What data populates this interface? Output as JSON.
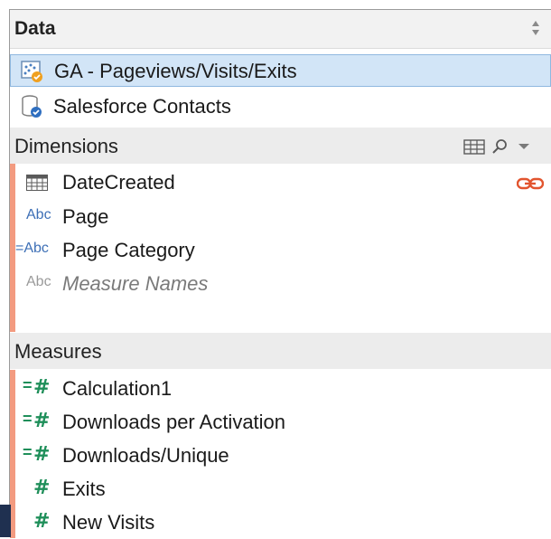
{
  "header": {
    "title": "Data"
  },
  "datasources": [
    {
      "label": "GA - Pageviews/Visits/Exits",
      "icon": "ga-datasource-icon",
      "selected": true
    },
    {
      "label": "Salesforce Contacts",
      "icon": "salesforce-datasource-icon",
      "selected": false
    }
  ],
  "dimensions": {
    "title": "Dimensions",
    "fields": [
      {
        "label": "DateCreated",
        "icon": "date-icon",
        "linked": true
      },
      {
        "label": "Page",
        "icon_text": "Abc"
      },
      {
        "label": "Page Category",
        "icon_text": "=Abc"
      },
      {
        "label": "Measure Names",
        "icon_text": "Abc",
        "italic": true
      }
    ]
  },
  "measures": {
    "title": "Measures",
    "fields": [
      {
        "label": "Calculation1",
        "calculated": true
      },
      {
        "label": "Downloads per Activation",
        "calculated": true
      },
      {
        "label": "Downloads/Unique",
        "calculated": true
      },
      {
        "label": "Exits",
        "calculated": false
      },
      {
        "label": "New Visits",
        "calculated": false
      }
    ]
  },
  "colors": {
    "accent_bar": "#f39b80",
    "selected_row": "#d2e5f7",
    "measure_green": "#1f8f5a",
    "dimension_blue": "#3d6fb6",
    "link_red": "#e2552f"
  }
}
